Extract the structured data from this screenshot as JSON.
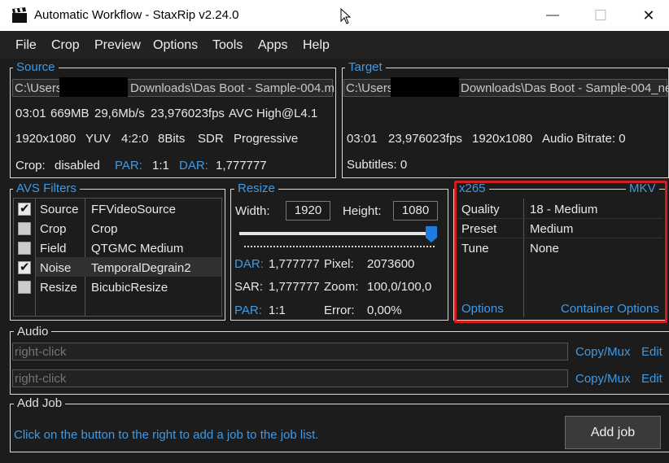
{
  "window": {
    "title": "Automatic Workflow - StaxRip v2.24.0",
    "minimize": "—",
    "maximize": "☐",
    "close": "✕"
  },
  "menu": [
    "File",
    "Crop",
    "Preview",
    "Options",
    "Tools",
    "Apps",
    "Help"
  ],
  "source": {
    "legend": "Source",
    "path_prefix": "C:\\Users\\",
    "path_suffix": "Downloads\\Das Boot - Sample-004.m",
    "line1": [
      "03:01",
      "669MB",
      "29,6Mb/s",
      "23,976023fps",
      "AVC",
      "High@L4.1"
    ],
    "line2": [
      "1920x1080",
      "YUV",
      "4:2:0",
      "8Bits",
      "SDR",
      "Progressive"
    ],
    "crop_label": "Crop:",
    "crop_value": "disabled",
    "par_label": "PAR:",
    "par_value": "1:1",
    "dar_label": "DAR:",
    "dar_value": "1,777777"
  },
  "target": {
    "legend": "Target",
    "path_prefix": "C:\\Users\\",
    "path_suffix": "Downloads\\Das Boot - Sample-004_ne",
    "line1": [
      "03:01",
      "23,976023fps",
      "1920x1080",
      "Audio Bitrate: 0"
    ],
    "subtitles": "Subtitles: 0"
  },
  "filters": {
    "legend": "AVS Filters",
    "rows": [
      {
        "checked": true,
        "name": "Source",
        "value": "FFVideoSource"
      },
      {
        "checked": false,
        "name": "Crop",
        "value": "Crop"
      },
      {
        "checked": false,
        "name": "Field",
        "value": "QTGMC Medium"
      },
      {
        "checked": true,
        "name": "Noise",
        "value": "TemporalDegrain2"
      },
      {
        "checked": false,
        "name": "Resize",
        "value": "BicubicResize"
      }
    ]
  },
  "resize": {
    "legend": "Resize",
    "width_label": "Width:",
    "width_value": "1920",
    "height_label": "Height:",
    "height_value": "1080",
    "slider_level_percent": 100,
    "dar_label": "DAR:",
    "dar_value": "1,777777",
    "pixel_label": "Pixel:",
    "pixel_value": "2073600",
    "sar_label": "SAR:",
    "sar_value": "1,777777",
    "zoom_label": "Zoom:",
    "zoom_value": "100,0/100,0",
    "par_label": "PAR:",
    "par_value": "1:1",
    "error_label": "Error:",
    "error_value": "0,00%"
  },
  "encoder": {
    "legend_left": "x265",
    "legend_right": "MKV",
    "rows": [
      {
        "name": "Quality",
        "value": "18 - Medium"
      },
      {
        "name": "Preset",
        "value": "Medium"
      },
      {
        "name": "Tune",
        "value": "None"
      }
    ],
    "options_link": "Options",
    "container_link": "Container Options",
    "highlight_color": "#d01f1f"
  },
  "audio": {
    "legend": "Audio",
    "tracks": [
      {
        "placeholder": "right-click",
        "copy": "Copy/Mux",
        "edit": "Edit"
      },
      {
        "placeholder": "right-click",
        "copy": "Copy/Mux",
        "edit": "Edit"
      }
    ]
  },
  "addjob": {
    "legend": "Add Job",
    "hint": "Click on the button to the right to add a job to the job list.",
    "button": "Add job"
  },
  "colors": {
    "link": "#3f9ae6",
    "background": "#1c1c1c"
  }
}
